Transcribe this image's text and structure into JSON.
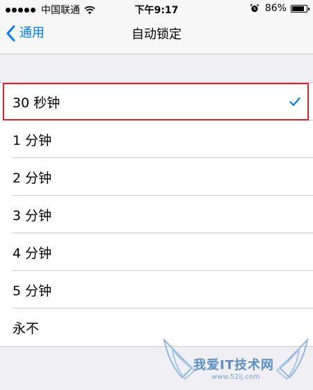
{
  "status_bar": {
    "carrier": "中国联通",
    "time": "下午9:17",
    "battery_percent": "86%",
    "battery_level": 0.86,
    "icons": [
      "signal-dots",
      "wifi-icon",
      "alarm-icon",
      "battery-icon"
    ]
  },
  "nav": {
    "back_label": "通用",
    "title": "自动锁定"
  },
  "options": [
    {
      "label": "30 秒钟",
      "selected": true
    },
    {
      "label": "1 分钟",
      "selected": false
    },
    {
      "label": "2 分钟",
      "selected": false
    },
    {
      "label": "3 分钟",
      "selected": false
    },
    {
      "label": "4 分钟",
      "selected": false
    },
    {
      "label": "5 分钟",
      "selected": false
    },
    {
      "label": "永不",
      "selected": false
    }
  ],
  "colors": {
    "accent": "#007aff",
    "highlight": "#d9232e",
    "background": "#efeff4"
  },
  "watermark": {
    "text": "我爱IT技术网",
    "url": "www.52ij.com"
  }
}
